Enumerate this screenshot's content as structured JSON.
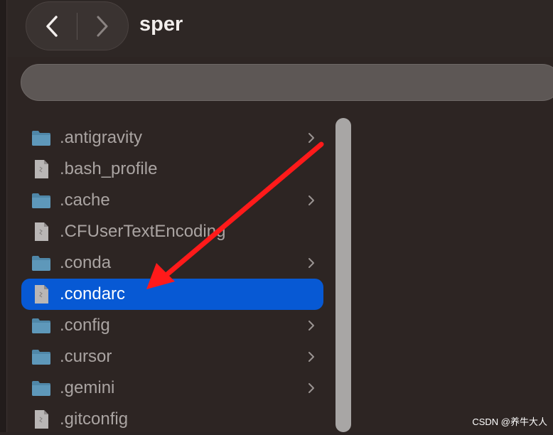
{
  "window": {
    "title": "sper"
  },
  "toolbar": {
    "back_icon": "chevron-left-icon",
    "forward_icon": "chevron-right-icon"
  },
  "files": [
    {
      "name": ".antigravity",
      "kind": "folder",
      "has_chevron": true,
      "selected": false
    },
    {
      "name": ".bash_profile",
      "kind": "file",
      "has_chevron": false,
      "selected": false
    },
    {
      "name": ".cache",
      "kind": "folder",
      "has_chevron": true,
      "selected": false
    },
    {
      "name": ".CFUserTextEncoding",
      "kind": "file",
      "has_chevron": false,
      "selected": false
    },
    {
      "name": ".conda",
      "kind": "folder",
      "has_chevron": true,
      "selected": false
    },
    {
      "name": ".condarc",
      "kind": "file",
      "has_chevron": false,
      "selected": true
    },
    {
      "name": ".config",
      "kind": "folder",
      "has_chevron": true,
      "selected": false
    },
    {
      "name": ".cursor",
      "kind": "folder",
      "has_chevron": true,
      "selected": false
    },
    {
      "name": ".gemini",
      "kind": "folder",
      "has_chevron": true,
      "selected": false
    },
    {
      "name": ".gitconfig",
      "kind": "file",
      "has_chevron": false,
      "selected": false
    }
  ],
  "colors": {
    "selection": "#0759d4",
    "folder": "#4f87a8",
    "arrow": "#ff1a1a"
  },
  "watermark": "CSDN @养牛大人"
}
